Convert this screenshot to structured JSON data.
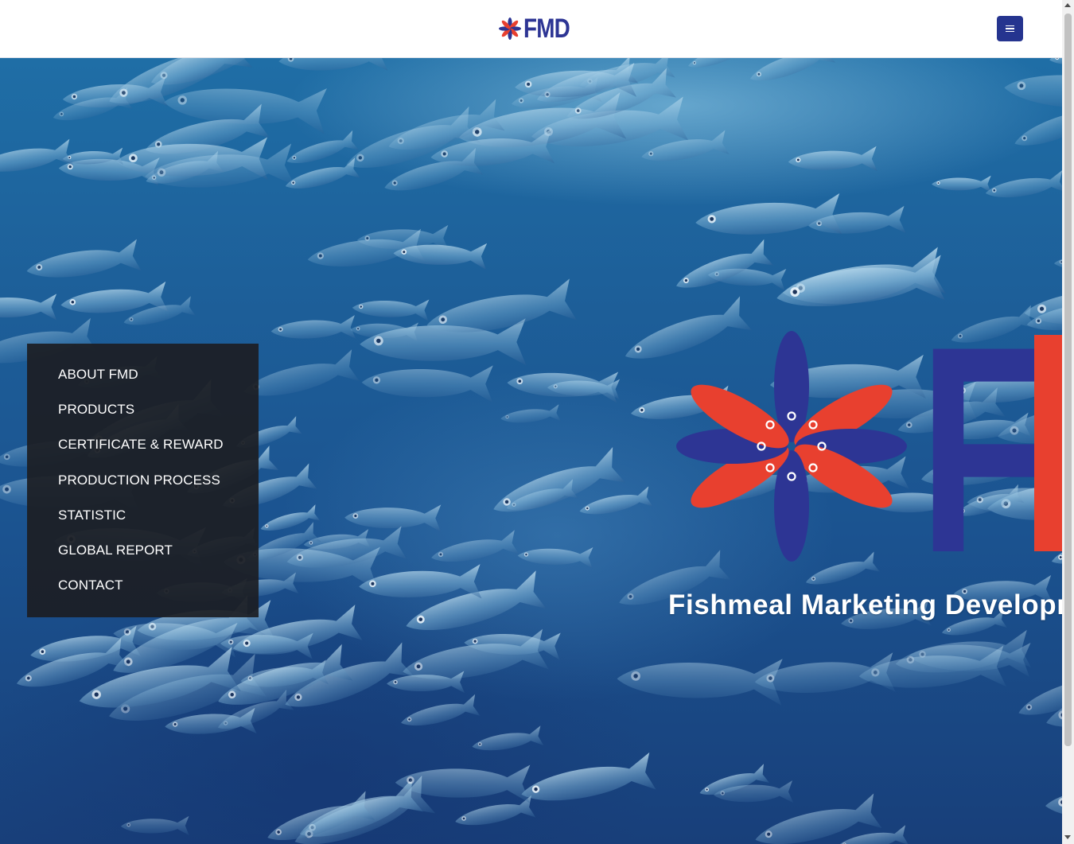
{
  "header": {
    "logo_text": "FMD",
    "menu_icon": "hamburger-icon"
  },
  "menu": {
    "items": [
      {
        "label": "ABOUT FMD"
      },
      {
        "label": "PRODUCTS"
      },
      {
        "label": "CERTIFICATE & REWARD"
      },
      {
        "label": "PRODUCTION PROCESS"
      },
      {
        "label": "STATISTIC"
      },
      {
        "label": "GLOBAL REPORT"
      },
      {
        "label": "CONTACT"
      }
    ]
  },
  "hero": {
    "background": "school-of-fish-underwater-photo",
    "brand_letters": "FMD",
    "tagline": "Fishmeal Marketing Development"
  },
  "colors": {
    "brand_blue": "#2d3594",
    "brand_red": "#e8402f",
    "button_blue": "#25348f",
    "menu_panel": "#1c1e24"
  }
}
